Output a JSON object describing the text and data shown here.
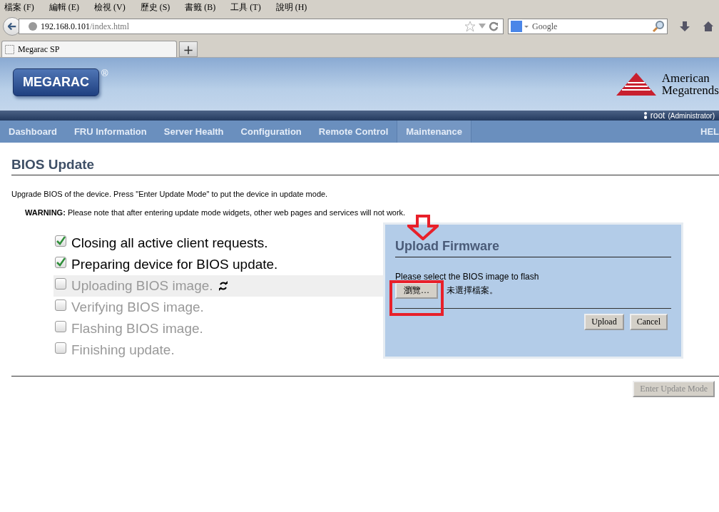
{
  "browser": {
    "menu": [
      "檔案 (F)",
      "編輯 (E)",
      "檢視 (V)",
      "歷史 (S)",
      "書籤 (B)",
      "工具 (T)",
      "說明 (H)"
    ],
    "url_host": "192.168.0.101",
    "url_path": "/index.html",
    "search_placeholder": "Google",
    "tab_title": "Megarac SP",
    "new_tab": "+"
  },
  "header": {
    "logo": "MEGARAC",
    "registered": "®",
    "brand_line_1": "American",
    "brand_line_2": "Megatrends",
    "user": "root",
    "role": "(Administrator)"
  },
  "nav": [
    {
      "label": "Dashboard",
      "selected": false
    },
    {
      "label": "FRU Information",
      "selected": false
    },
    {
      "label": "Server Health",
      "selected": false
    },
    {
      "label": "Configuration",
      "selected": false
    },
    {
      "label": "Remote Control",
      "selected": false
    },
    {
      "label": "Maintenance",
      "selected": true
    },
    {
      "label": "HEL",
      "selected": false
    }
  ],
  "page": {
    "title": "BIOS Update",
    "description": "Upgrade BIOS of the device. Press \"Enter Update Mode\" to put the device in update mode.",
    "warning": "**WARNING:** Please note that after entering update mode widgets, other web pages and services will not work."
  },
  "steps": [
    {
      "label": "Closing all active client requests.",
      "checked": true,
      "active": false
    },
    {
      "label": "Preparing device for BIOS update.",
      "checked": true,
      "active": false
    },
    {
      "label": "Uploading BIOS image.",
      "checked": false,
      "active": true
    },
    {
      "label": "Verifying BIOS image.",
      "checked": false,
      "active": false
    },
    {
      "label": "Flashing BIOS image.",
      "checked": false,
      "active": false
    },
    {
      "label": "Finishing update.",
      "checked": false,
      "active": false
    }
  ],
  "upload": {
    "title": "Upload Firmware",
    "prompt": "Please select the BIOS image to flash",
    "browse_button": "瀏覽…",
    "file_status": "未選擇檔案。",
    "buttons": [
      "Upload",
      "Cancel"
    ]
  },
  "enter_button": {
    "label": "Enter Update Mode",
    "disabled": true
  }
}
